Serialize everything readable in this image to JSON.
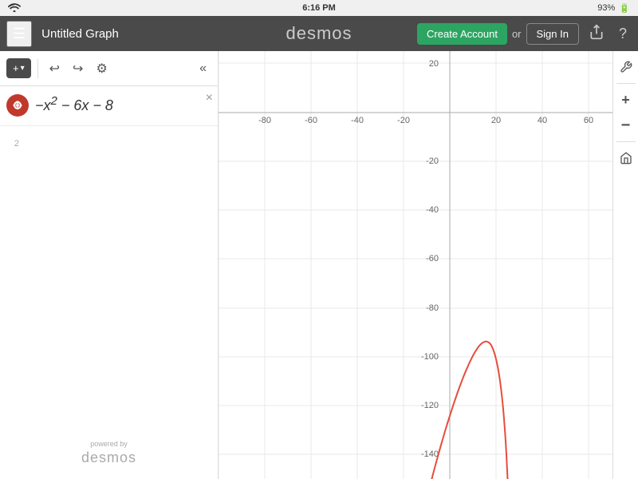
{
  "status_bar": {
    "wifi_icon": "wifi",
    "time": "6:16 PM",
    "battery": "93%"
  },
  "nav": {
    "menu_icon": "☰",
    "graph_title": "Untitled Graph",
    "desmos_logo": "desmos",
    "create_account_label": "Create Account",
    "or_text": "or",
    "sign_in_label": "Sign In",
    "share_icon": "share",
    "help_icon": "?"
  },
  "left_panel": {
    "add_label": "+",
    "undo_icon": "↩",
    "redo_icon": "↪",
    "settings_icon": "⚙",
    "collapse_icon": "«",
    "expressions": [
      {
        "id": 1,
        "formula": "-x² - 6x - 8",
        "formula_display": "-x² - 6x - 8",
        "color": "#c0392b"
      }
    ],
    "row2_number": "2"
  },
  "powered_by": {
    "small_text": "powered by",
    "logo_text": "desmos"
  },
  "graph": {
    "x_labels": [
      "-80",
      "-60",
      "-40",
      "-20",
      "",
      "20",
      "40",
      "60"
    ],
    "y_labels": [
      "20",
      "-20",
      "-40",
      "-60",
      "-80",
      "-100",
      "-120",
      "-140"
    ],
    "curve_color": "#e74c3c"
  },
  "right_toolbar": {
    "wrench_icon": "🔧",
    "plus_icon": "+",
    "minus_icon": "−",
    "home_icon": "⌂"
  }
}
